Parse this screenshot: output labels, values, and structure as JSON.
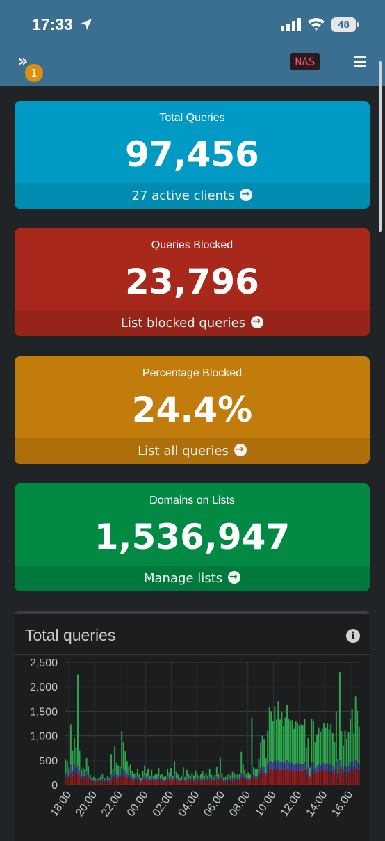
{
  "status": {
    "time": "17:33",
    "battery": "48"
  },
  "navbar": {
    "notifications": "1",
    "host": "NAS"
  },
  "cards": [
    {
      "label": "Total Queries",
      "value": "97,456",
      "link": "27 active clients",
      "color": "#009ac4"
    },
    {
      "label": "Queries Blocked",
      "value": "23,796",
      "link": "List blocked queries",
      "color": "#a8291c"
    },
    {
      "label": "Percentage Blocked",
      "value": "24.4%",
      "link": "List all queries",
      "color": "#c27c0c"
    },
    {
      "label": "Domains on Lists",
      "value": "1,536,947",
      "link": "Manage lists",
      "color": "#028a45"
    }
  ],
  "chart_panel": {
    "title": "Total queries"
  },
  "chart_data": {
    "type": "bar",
    "stacked": true,
    "ylim": [
      0,
      2500
    ],
    "yticks": [
      "2,500",
      "2,000",
      "1,500",
      "1,000",
      "500",
      "0"
    ],
    "xticks": [
      "18:00",
      "20:00",
      "22:00",
      "00:00",
      "02:00",
      "04:00",
      "06:00",
      "08:00",
      "10:00",
      "12:00",
      "14:00",
      "16:00"
    ],
    "series_colors": {
      "blocked": "#8e1c1c",
      "cached": "#3d4a9a",
      "forwarded": "#2ea84f"
    },
    "totals": [
      520,
      480,
      350,
      1230,
      700,
      950,
      760,
      2250,
      700,
      300,
      350,
      320,
      550,
      380,
      200,
      130,
      160,
      120,
      110,
      140,
      160,
      220,
      130,
      120,
      180,
      140,
      620,
      320,
      780,
      440,
      390,
      380,
      1090,
      870,
      680,
      480,
      380,
      420,
      280,
      230,
      240,
      330,
      220,
      140,
      280,
      390,
      240,
      330,
      170,
      300,
      180,
      210,
      210,
      340,
      200,
      230,
      160,
      180,
      320,
      250,
      340,
      190,
      480,
      260,
      210,
      140,
      180,
      350,
      160,
      300,
      220,
      180,
      240,
      190,
      290,
      210,
      170,
      220,
      280,
      190,
      240,
      170,
      320,
      200,
      150,
      200,
      360,
      220,
      560,
      240,
      150,
      160,
      200,
      220,
      190,
      260,
      230,
      210,
      210,
      220,
      670,
      420,
      300,
      230,
      250,
      210,
      1370,
      370,
      330,
      320,
      530,
      860,
      1000,
      920,
      550,
      1100,
      1580,
      1500,
      1300,
      1600,
      1330,
      1700,
      1330,
      1480,
      1200,
      1370,
      1620,
      1350,
      1310,
      1320,
      1140,
      1290,
      1260,
      1200,
      1230,
      1220,
      1350,
      760,
      950,
      350,
      1350,
      1290,
      870,
      1030,
      1170,
      1080,
      1140,
      1250,
      1170,
      1260,
      1130,
      1240,
      1050,
      870,
      1500,
      530,
      2300,
      1090,
      800,
      1100,
      940,
      1070,
      1350,
      1550,
      1050,
      1800,
      1510,
      1180
    ],
    "blocked": [
      160,
      150,
      120,
      240,
      170,
      260,
      220,
      230,
      180,
      110,
      120,
      120,
      170,
      130,
      80,
      60,
      70,
      50,
      50,
      60,
      70,
      80,
      60,
      50,
      70,
      60,
      120,
      110,
      160,
      130,
      120,
      120,
      200,
      190,
      170,
      140,
      120,
      130,
      100,
      90,
      90,
      110,
      80,
      60,
      100,
      120,
      90,
      110,
      70,
      100,
      70,
      80,
      80,
      110,
      80,
      90,
      60,
      70,
      110,
      90,
      110,
      70,
      130,
      90,
      80,
      60,
      70,
      110,
      60,
      100,
      80,
      70,
      90,
      70,
      100,
      80,
      70,
      80,
      90,
      70,
      90,
      70,
      100,
      80,
      60,
      80,
      110,
      80,
      150,
      90,
      60,
      60,
      80,
      80,
      70,
      90,
      90,
      80,
      80,
      80,
      150,
      130,
      100,
      90,
      90,
      80,
      240,
      130,
      120,
      120,
      160,
      220,
      250,
      240,
      160,
      260,
      300,
      310,
      290,
      320,
      300,
      330,
      290,
      300,
      280,
      290,
      320,
      290,
      280,
      290,
      260,
      290,
      280,
      270,
      280,
      270,
      300,
      200,
      230,
      110,
      300,
      290,
      220,
      250,
      270,
      260,
      270,
      290,
      270,
      290,
      260,
      280,
      250,
      220,
      310,
      150,
      320,
      250,
      210,
      250,
      230,
      250,
      300,
      320,
      250,
      330,
      310,
      270
    ],
    "cached": [
      80,
      70,
      60,
      160,
      110,
      150,
      120,
      160,
      110,
      60,
      60,
      60,
      90,
      70,
      40,
      30,
      30,
      30,
      30,
      30,
      30,
      40,
      30,
      30,
      40,
      30,
      90,
      60,
      110,
      70,
      70,
      70,
      140,
      120,
      100,
      80,
      70,
      70,
      50,
      50,
      50,
      60,
      40,
      30,
      50,
      70,
      50,
      60,
      40,
      60,
      40,
      40,
      40,
      60,
      40,
      40,
      30,
      40,
      60,
      50,
      60,
      40,
      80,
      50,
      40,
      30,
      40,
      60,
      30,
      60,
      40,
      40,
      40,
      40,
      50,
      40,
      40,
      40,
      50,
      40,
      40,
      40,
      60,
      40,
      30,
      40,
      60,
      40,
      90,
      40,
      30,
      30,
      40,
      40,
      40,
      50,
      40,
      40,
      40,
      40,
      90,
      70,
      50,
      40,
      50,
      40,
      150,
      70,
      60,
      60,
      80,
      120,
      130,
      120,
      80,
      140,
      170,
      170,
      160,
      180,
      160,
      180,
      160,
      170,
      150,
      160,
      180,
      160,
      150,
      160,
      140,
      150,
      150,
      150,
      150,
      150,
      160,
      100,
      120,
      60,
      160,
      150,
      110,
      130,
      140,
      130,
      140,
      150,
      140,
      150,
      140,
      150,
      130,
      110,
      160,
      80,
      180,
      130,
      110,
      130,
      120,
      130,
      150,
      160,
      130,
      170,
      160,
      140
    ]
  }
}
